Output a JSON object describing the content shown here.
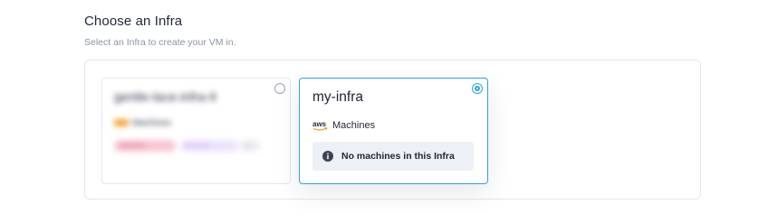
{
  "section": {
    "title": "Choose an Infra",
    "subtitle": "Select an Infra to create your VM in."
  },
  "infras": [
    {
      "name": "gentle-lace-infra-9",
      "provider_label": "Machines",
      "tags": [
        "xxxxxxxx",
        "xx-xx-xx",
        "x"
      ],
      "selected": false,
      "blurred": true
    },
    {
      "name": "my-infra",
      "provider_logo_text": "aws",
      "provider_label": "Machines",
      "notice": "No machines in this Infra",
      "selected": true,
      "blurred": false
    }
  ],
  "colors": {
    "accent": "#2fa4d6",
    "aws_orange": "#f29a1f",
    "notice_bg": "#edf0f4"
  },
  "icons": {
    "provider": "aws-logo-icon",
    "notice": "info-circle-icon"
  }
}
